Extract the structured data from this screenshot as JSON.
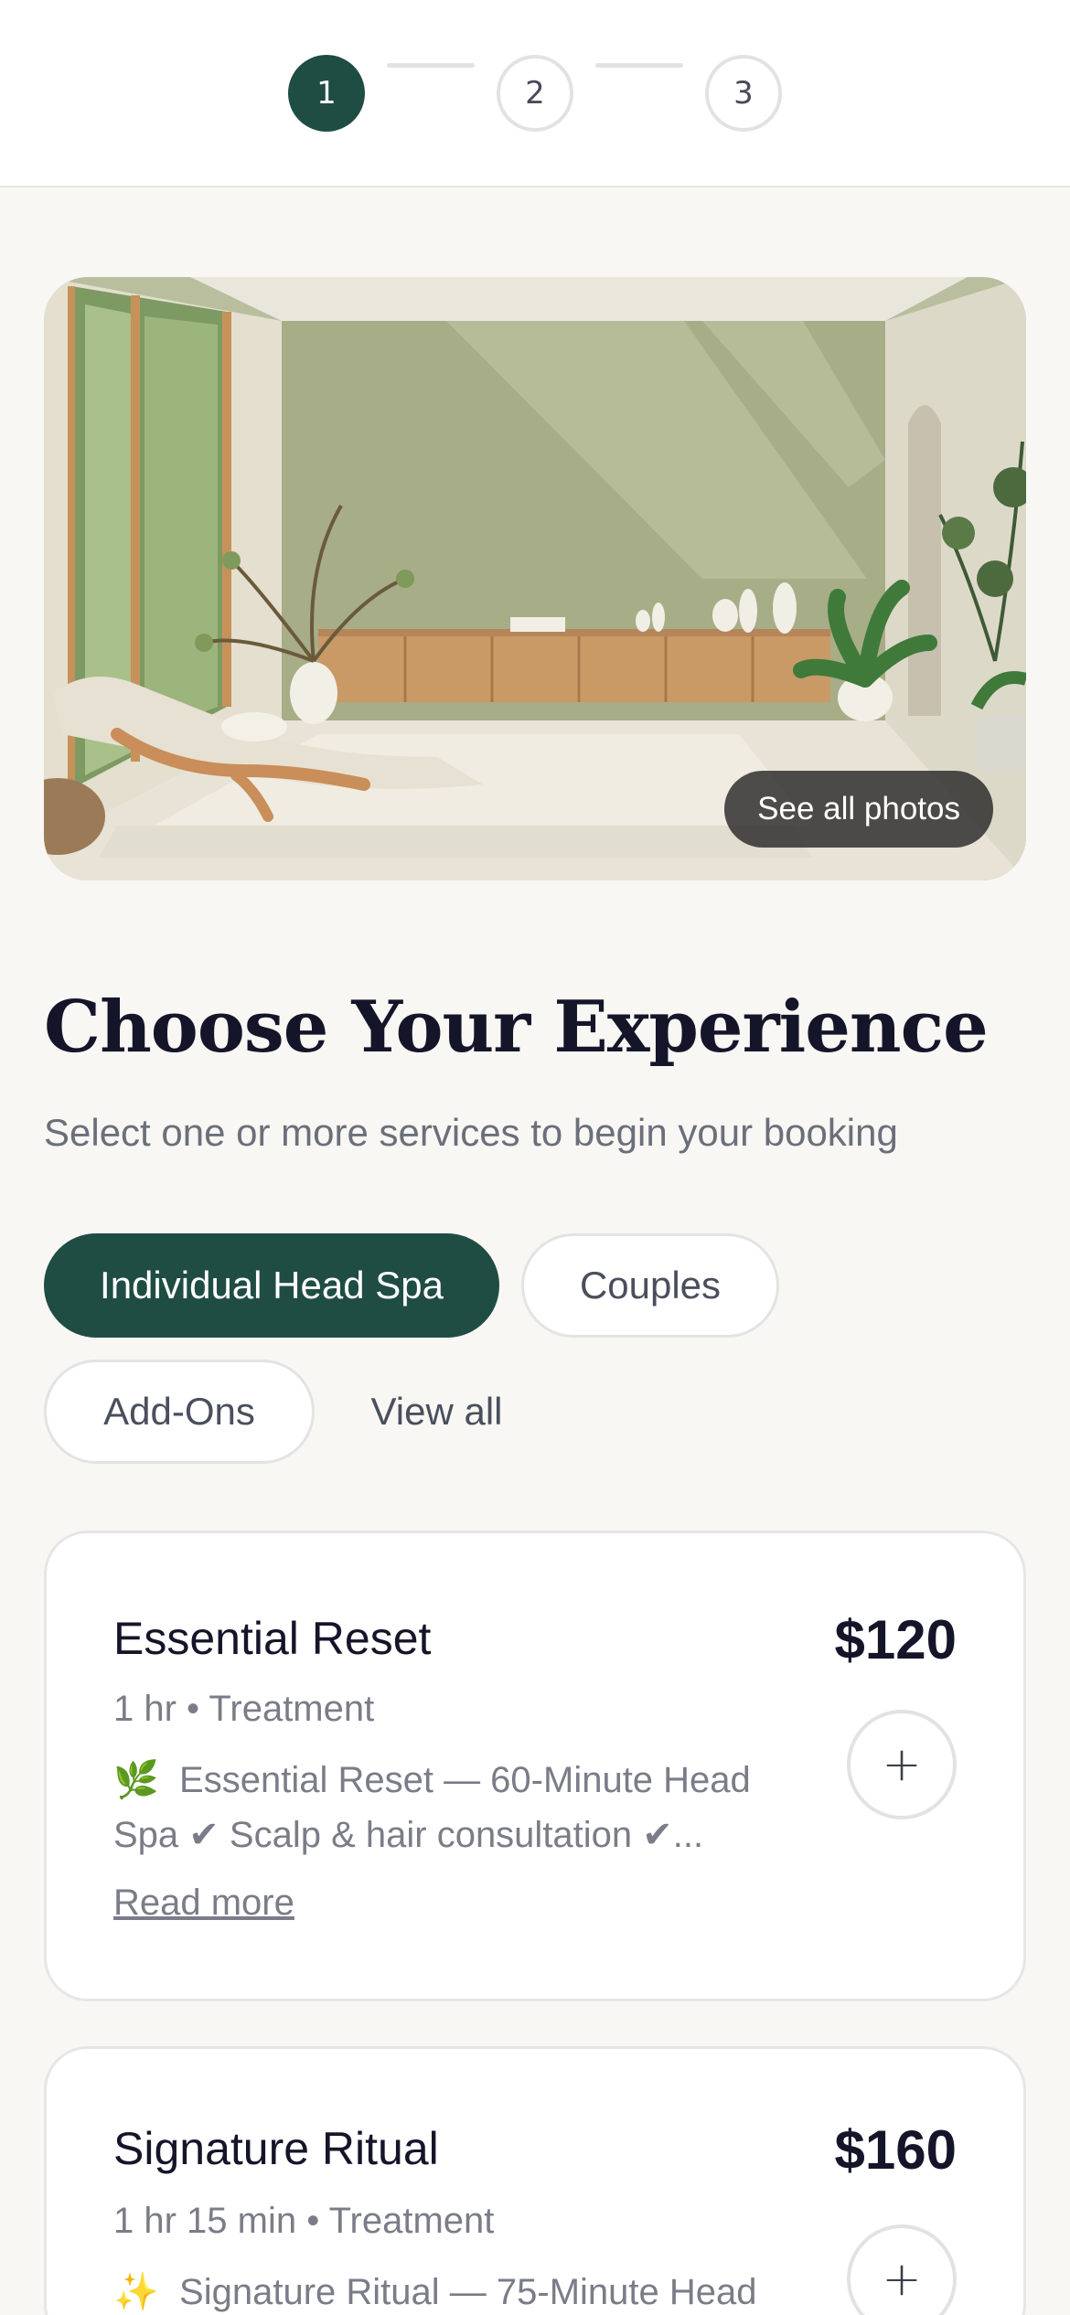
{
  "stepper": {
    "steps": [
      "1",
      "2",
      "3"
    ],
    "active_index": 0
  },
  "hero": {
    "see_all_label": "See all photos"
  },
  "heading": {
    "title": "Choose Your Experience",
    "subtitle": "Select one or more services to begin your booking"
  },
  "filters": {
    "items": [
      "Individual Head Spa",
      "Couples",
      "Add-Ons",
      "View all"
    ],
    "selected": "Individual Head Spa"
  },
  "services": [
    {
      "name": "Essential Reset",
      "price": "$120",
      "meta": "1 hr • Treatment",
      "icon": "🌿",
      "desc_line1": "Essential Reset — 60-Minute Head",
      "desc_line2": "Spa ✔ Scalp & hair consultation ✔...",
      "read_more": "Read more",
      "add_label": "+"
    },
    {
      "name": "Signature Ritual",
      "price": "$160",
      "meta": "1 hr 15 min • Treatment",
      "icon": "✨",
      "desc_line1": "Signature Ritual — 75-Minute Head",
      "add_label": "+"
    }
  ],
  "colors": {
    "brand_green": "#1f4d43",
    "background": "#f8f7f4",
    "text_dark": "#15152a",
    "text_muted": "#7a7d87"
  }
}
